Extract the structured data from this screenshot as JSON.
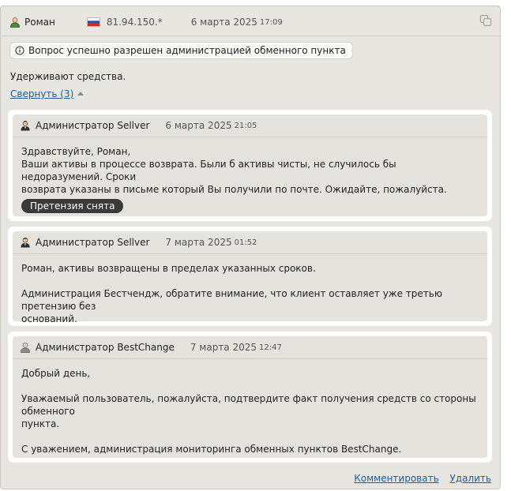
{
  "header": {
    "user_name": "Роман",
    "ip": "81.94.150.*",
    "date": "6 марта 2025",
    "time": "17:09",
    "icons": {
      "user": "user-icon",
      "flag": "russia-flag-icon",
      "copy": "copy-icon"
    }
  },
  "notice": {
    "icon": "info-icon",
    "text": "Вопрос успешно разрешен администрацией обменного пункта"
  },
  "main_message": "Удерживают средства.",
  "collapse_label": "Свернуть (3)",
  "replies": [
    {
      "author": "Администратор Sellver",
      "date": "6 марта 2025",
      "time": "21:05",
      "lines": [
        "Здравствуйте, Роман,",
        "Ваши активы в процессе возврата. Были б активы чисты, не случилось бы недоразумений. Сроки",
        "возврата указаны в письме который Вы получили по почте. Ожидайте, пожалуйста."
      ],
      "badge": "Претензия снята"
    },
    {
      "author": "Администратор Sellver",
      "date": "7 марта 2025",
      "time": "01:52",
      "p1": "Роман, активы возвращены в пределах указанных сроков.",
      "p2_l1": "Администрация Бестчендж, обратите внимание, что клиент оставляет уже третью претензию без",
      "p2_l2": "оснований."
    },
    {
      "author": "Администратор BestChange",
      "date": "7 марта 2025",
      "time": "12:47",
      "p1": "Добрый день,",
      "p2_l1": "Уважаемый пользователь, пожалуйста, подтвердите факт получения средств со стороны обменного",
      "p2_l2": "пункта.",
      "p3": "С уважением, администрация мониторинга обменных пунктов BestChange."
    }
  ],
  "footer": {
    "comment": "Комментировать",
    "delete": "Удалить"
  },
  "colors": {
    "card_bg": "#e7e6e1",
    "link": "#1b5c9e",
    "badge_bg": "#3a3a3a"
  }
}
